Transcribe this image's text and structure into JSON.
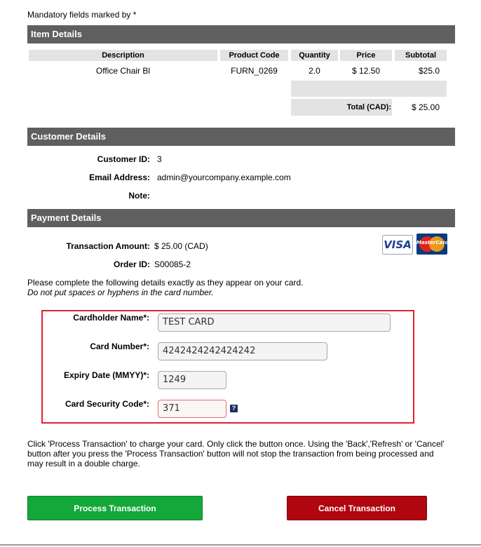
{
  "mandatory_note": "Mandatory fields marked by *",
  "item_details": {
    "heading": "Item Details",
    "columns": [
      "Description",
      "Product Code",
      "Quantity",
      "Price",
      "Subtotal"
    ],
    "row": {
      "description": "Office Chair Bl",
      "product_code": "FURN_0269",
      "quantity": "2.0",
      "price": "$ 12.50",
      "subtotal": "$25.0"
    },
    "total_label": "Total (CAD):",
    "total_value": "$ 25.00"
  },
  "customer_details": {
    "heading": "Customer Details",
    "customer_id_label": "Customer ID:",
    "customer_id": "3",
    "email_label": "Email Address:",
    "email": "admin@yourcompany.example.com",
    "note_label": "Note:"
  },
  "payment_details": {
    "heading": "Payment Details",
    "amount_label": "Transaction Amount:",
    "amount": "$ 25.00 (CAD)",
    "order_label": "Order ID:",
    "order_id": "S00085-2",
    "card_logos": [
      "VISA",
      "MasterCard"
    ],
    "instructions_line1": "Please complete the following details exactly as they appear on your card.",
    "instructions_line2": "Do not put spaces or hyphens in the card number."
  },
  "card_form": {
    "cardholder_label": "Cardholder Name*:",
    "cardholder_value": "TEST CARD",
    "card_number_label": "Card Number*:",
    "card_number_value": "4242424242424242",
    "expiry_label": "Expiry Date (MMYY)*:",
    "expiry_value": "1249",
    "cvc_label": "Card Security Code*:",
    "cvc_value": "371",
    "help_icon": "?"
  },
  "warning_text": {
    "line1": "Click 'Process Transaction' to charge your card. Only click the button once. Using the 'Back','Refresh' or 'Cancel'",
    "line2": "button after you press the 'Process Transaction' button will not stop the transaction from being processed and",
    "line3": "may result in a double charge."
  },
  "buttons": {
    "process": "Process Transaction",
    "cancel": "Cancel Transaction"
  },
  "colors": {
    "section_bar": "#5f5f5f",
    "process_button": "#14a83b",
    "cancel_button": "#b0060f",
    "highlight_border": "#e2202d"
  }
}
